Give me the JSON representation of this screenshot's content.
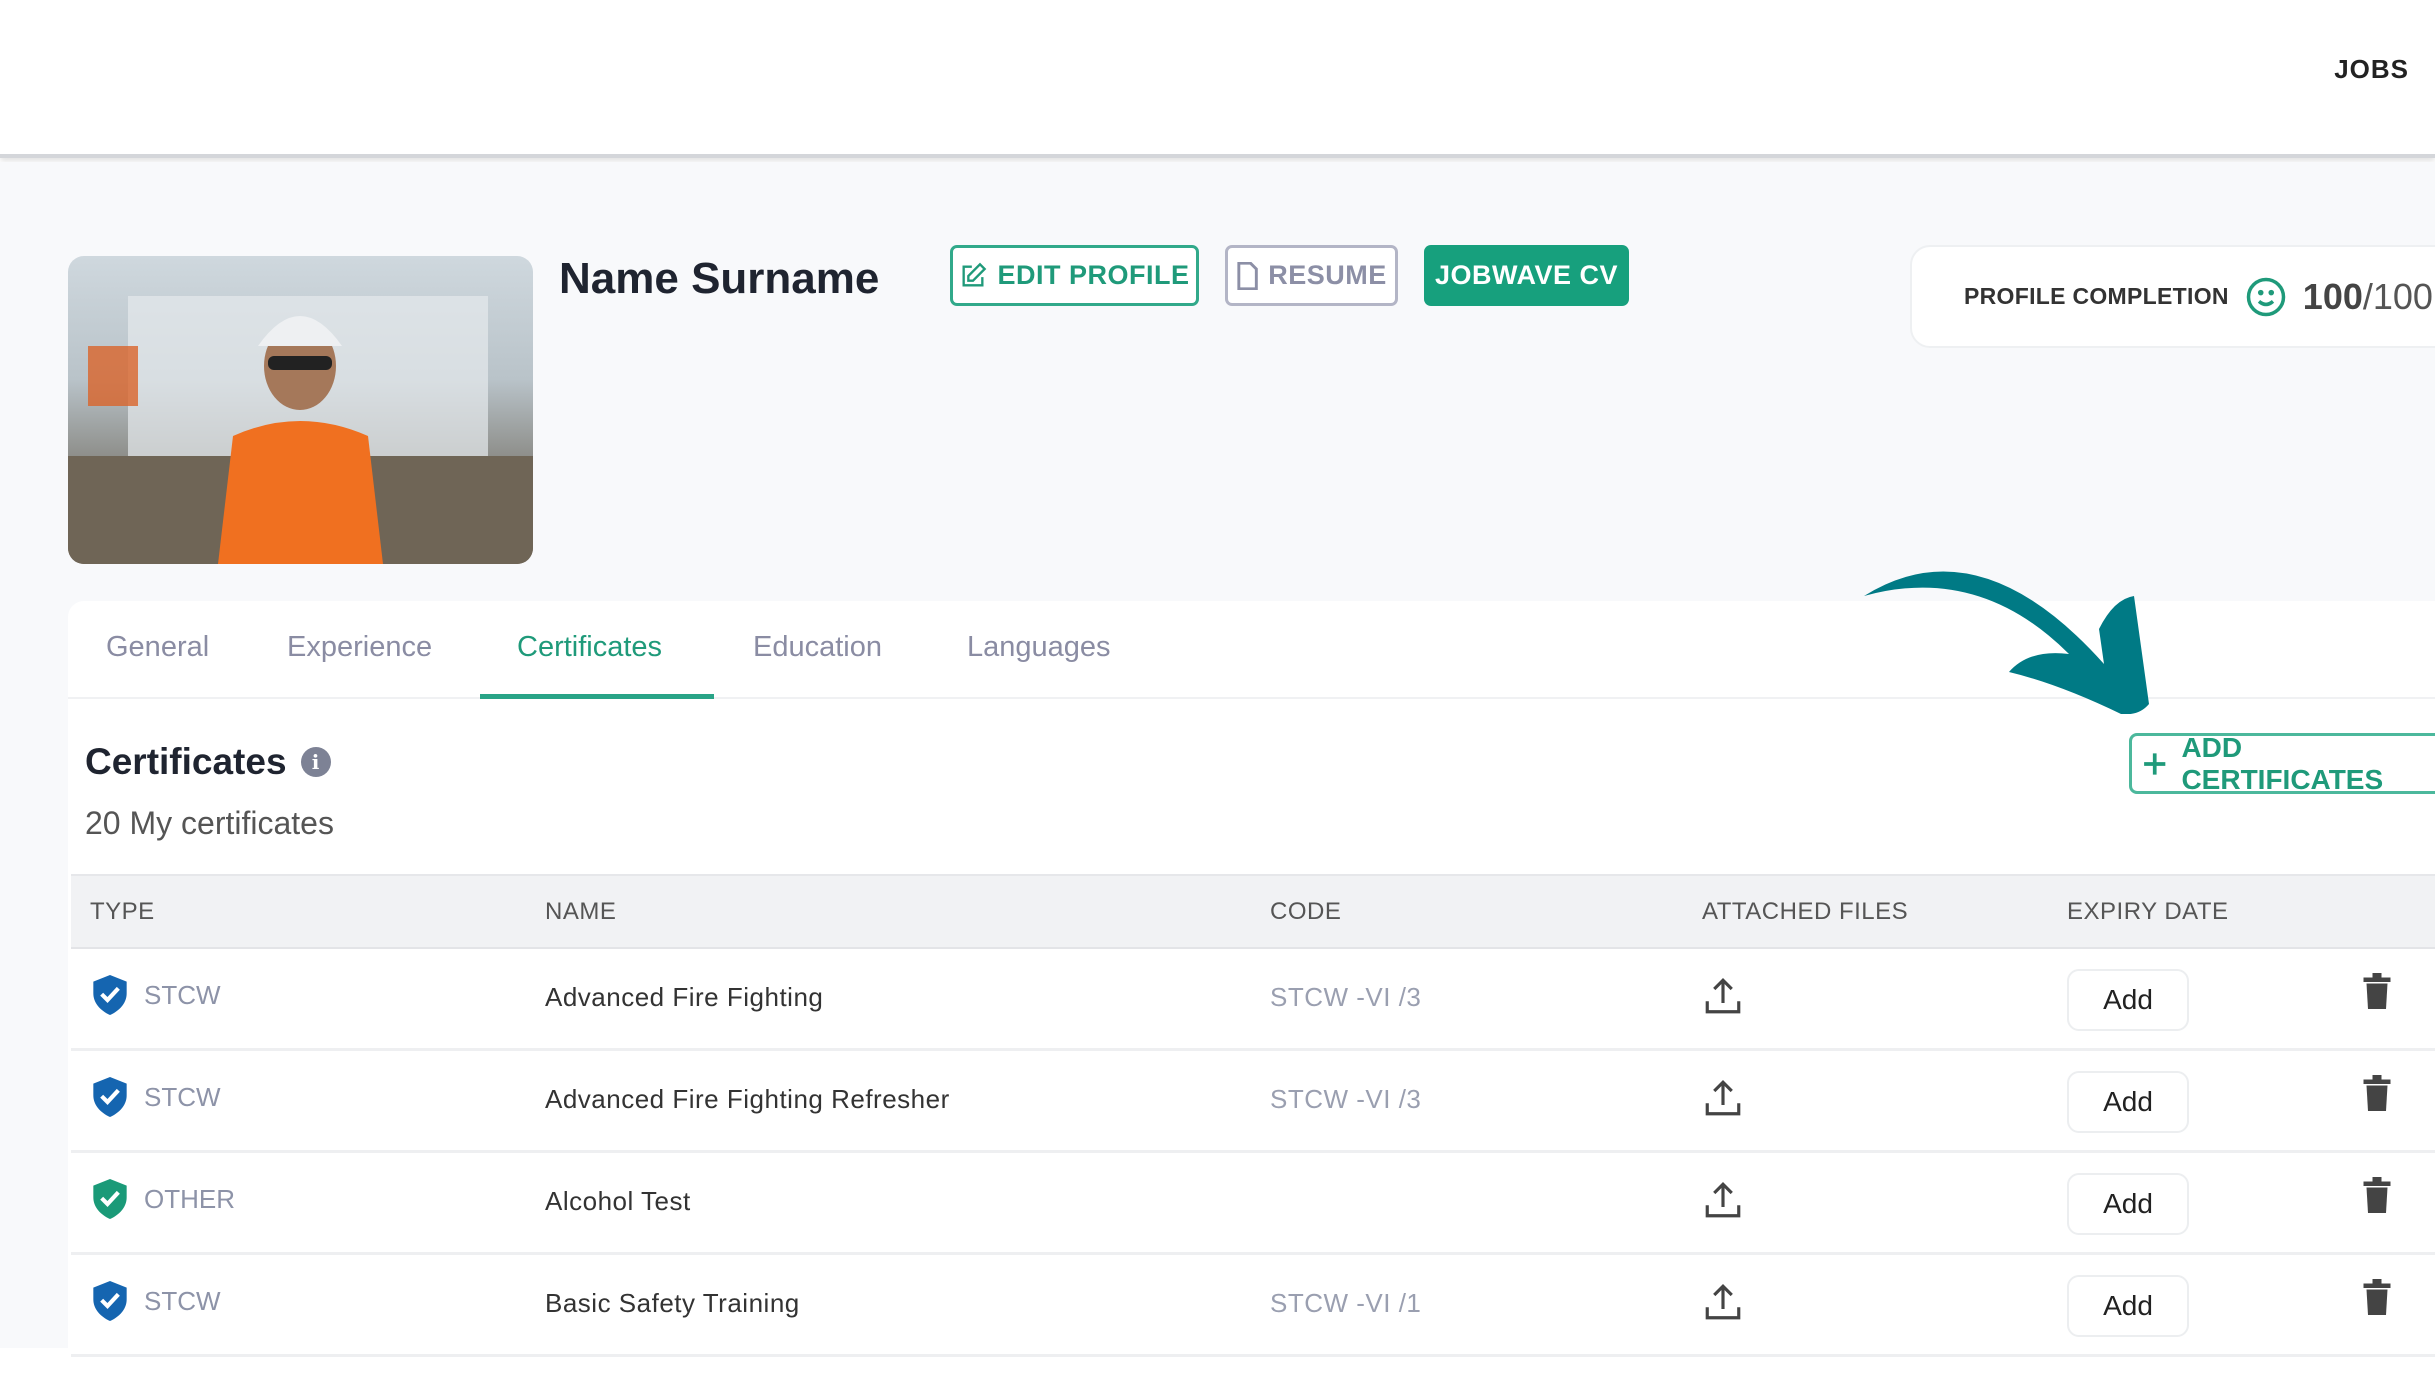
{
  "nav": {
    "jobs_label": "JOBS"
  },
  "profile": {
    "name": "Name Surname",
    "edit_label": "EDIT PROFILE",
    "resume_label": "RESUME",
    "jobwave_label": "JOBWAVE CV",
    "completion_label": "PROFILE COMPLETION",
    "completion_score": "100",
    "completion_total": "/100"
  },
  "tabs": [
    {
      "label": "General"
    },
    {
      "label": "Experience"
    },
    {
      "label": "Certificates",
      "active": true
    },
    {
      "label": "Education"
    },
    {
      "label": "Languages"
    }
  ],
  "certificates": {
    "title": "Certificates",
    "subtitle": "20 My certificates",
    "add_label": "ADD CERTIFICATES",
    "columns": [
      "TYPE",
      "NAME",
      "CODE",
      "ATTACHED FILES",
      "EXPIRY DATE"
    ],
    "rows": [
      {
        "type": "STCW",
        "name": "Advanced Fire Fighting",
        "code": "STCW -VI /3",
        "expiry_button": "Add",
        "shield_color": "#1565b0"
      },
      {
        "type": "STCW",
        "name": "Advanced Fire Fighting Refresher",
        "code": "STCW -VI /3",
        "expiry_button": "Add",
        "shield_color": "#1565b0"
      },
      {
        "type": "OTHER",
        "name": "Alcohol Test",
        "code": "",
        "expiry_button": "Add",
        "shield_color": "#1a9a78"
      },
      {
        "type": "STCW",
        "name": "Basic Safety Training",
        "code": "STCW -VI /1",
        "expiry_button": "Add",
        "shield_color": "#1565b0"
      }
    ]
  },
  "colors": {
    "accent": "#17a07d",
    "arrow": "#007a85"
  }
}
